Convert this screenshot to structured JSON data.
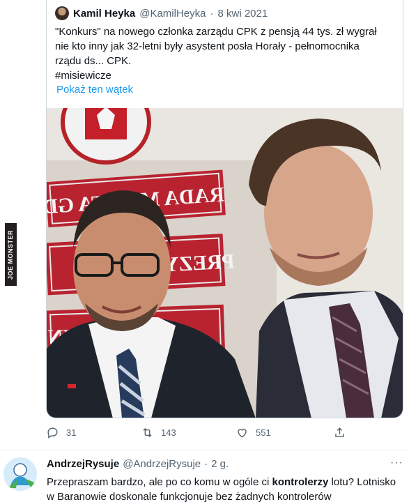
{
  "quoted_tweet": {
    "author_name": "Kamil Heyka",
    "handle": "@KamilHeyka",
    "separator": "·",
    "date": "8 kwi 2021",
    "text_lines": [
      "\"Konkurs\" na nowego członka zarządu CPK z pensją 44 tys. zł wygrał",
      "nie kto inny jak 32-letni były asystent posła Horały - pełnomocnika",
      "rządu ds... CPK.",
      "#misiewicze"
    ],
    "show_thread": "Pokaż ten wątek",
    "photo_sign_lines": [
      "RADA MIASTA GDY",
      "PREZY",
      "GDYN"
    ]
  },
  "actions": {
    "reply_count": "31",
    "retweet_count": "143",
    "like_count": "551"
  },
  "reply": {
    "author_name": "AndrzejRysuje",
    "handle": "@AndrzejRysuje",
    "separator": "·",
    "time": "2 g.",
    "more": "···",
    "text_before": "Przepraszam bardzo, ale po co komu w ogóle ci ",
    "text_bold": "kontrolerzy",
    "text_after": " lotu? Lotnisko",
    "text_line2": "w Baranowie doskonale funkcjonuje bez żadnych kontrolerów"
  },
  "watermark": "JOE MONSTER",
  "colors": {
    "accent": "#1d9bf0",
    "muted": "#536471",
    "border": "#cfd9de"
  }
}
